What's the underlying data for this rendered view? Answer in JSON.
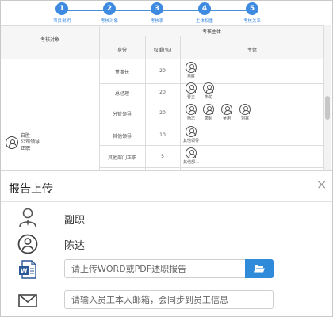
{
  "stepper": {
    "steps": [
      {
        "num": "1",
        "label": "项目说明"
      },
      {
        "num": "2",
        "label": "考核对象"
      },
      {
        "num": "3",
        "label": "考核表"
      },
      {
        "num": "4",
        "label": "主体权重"
      },
      {
        "num": "5",
        "label": "考核关系"
      }
    ]
  },
  "table": {
    "col_target": "考核对象",
    "col_subject_group": "考核主体",
    "col_role": "身份",
    "col_weight": "权重(%)",
    "col_subject": "主体",
    "target": {
      "line1": "自胜",
      "line2": "公司领导",
      "line3": "正职"
    },
    "rows": [
      {
        "role": "董事长",
        "weight": "20",
        "people": [
          "自胜"
        ]
      },
      {
        "role": "总经理",
        "weight": "20",
        "people": [
          "曹正",
          "朱龙"
        ]
      },
      {
        "role": "分管领导",
        "weight": "20",
        "people": [
          "杨志",
          "萧超",
          "吴用",
          "刘寨"
        ]
      },
      {
        "role": "其他领导",
        "weight": "10",
        "people": [
          "其他领导"
        ]
      },
      {
        "role": "其他部门正职",
        "weight": "5",
        "people": [
          "其他部..."
        ]
      }
    ]
  },
  "dialog": {
    "title": "报告上传",
    "close_glyph": "×",
    "position": "副职",
    "name": "陈达",
    "upload_placeholder": "请上传WORD或PDF述职报告",
    "email_placeholder": "请输入员工本人邮箱，会同步到员工信息"
  },
  "colors": {
    "accent": "#3d8ae0",
    "button": "#2f8bd9",
    "word_blue": "#2b5797"
  },
  "icons": [
    "position-person-icon",
    "user-circle-icon",
    "word-file-icon",
    "folder-open-icon",
    "envelope-icon",
    "close-icon"
  ]
}
